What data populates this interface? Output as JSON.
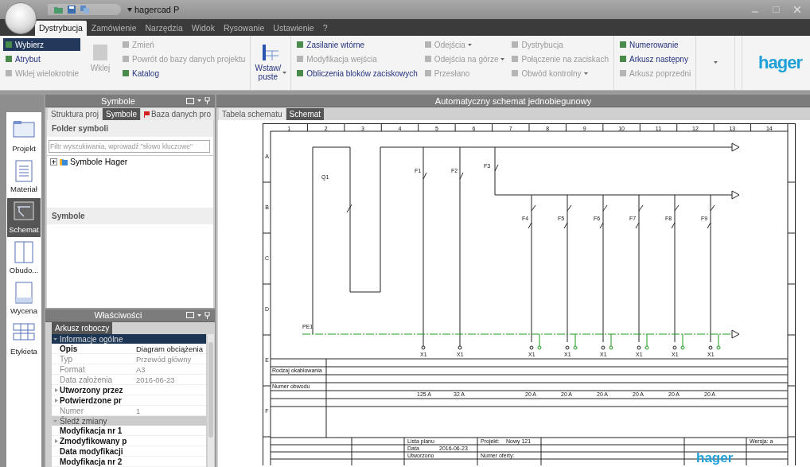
{
  "window": {
    "title": "hagercad P"
  },
  "menu_tabs": [
    {
      "label": "Dystrybucja",
      "selected": true
    },
    {
      "label": "Zamówienie",
      "selected": false
    },
    {
      "label": "Narzędzia",
      "selected": false
    },
    {
      "label": "Widok",
      "selected": false
    },
    {
      "label": "Rysowanie",
      "selected": false
    },
    {
      "label": "Ustawienie",
      "selected": false
    },
    {
      "label": "?",
      "selected": false
    }
  ],
  "ribbon": {
    "groups": [
      {
        "columns": [
          [
            {
              "kind": "small",
              "label": "Wybierz",
              "selected": true,
              "disabled": false
            },
            {
              "kind": "small",
              "label": "Atrybut",
              "selected": false,
              "disabled": false
            },
            {
              "kind": "small",
              "label": "Wklej wielokrotnie",
              "selected": false,
              "disabled": true
            }
          ],
          [
            {
              "kind": "large",
              "label": "Wklej",
              "disabled": true,
              "dropdown": false
            }
          ],
          [
            {
              "kind": "small",
              "label": "Zmień",
              "selected": false,
              "disabled": true
            },
            {
              "kind": "small",
              "label": "Powrót do bazy danych projektu",
              "selected": false,
              "disabled": true
            },
            {
              "kind": "small",
              "label": "Katalog",
              "selected": false,
              "disabled": false
            }
          ]
        ]
      },
      {
        "columns": [
          [
            {
              "kind": "large",
              "label": "Wstaw/ puste",
              "disabled": false,
              "dropdown": true
            }
          ]
        ]
      },
      {
        "columns": [
          [
            {
              "kind": "small",
              "label": "Zasilanie wtórne",
              "selected": false,
              "disabled": false
            },
            {
              "kind": "small",
              "label": "Modyfikacja wejścia",
              "selected": false,
              "disabled": true
            },
            {
              "kind": "small",
              "label": "Obliczenia bloków zaciskowych",
              "selected": false,
              "disabled": false
            }
          ],
          [
            {
              "kind": "small",
              "label": "Odejścia",
              "selected": false,
              "disabled": true,
              "dropdown": true
            },
            {
              "kind": "small",
              "label": "Odejścia na górze",
              "selected": false,
              "disabled": true,
              "dropdown": true
            },
            {
              "kind": "small",
              "label": "Przesłano",
              "selected": false,
              "disabled": true
            }
          ],
          [
            {
              "kind": "small",
              "label": "Dystrybucja",
              "selected": false,
              "disabled": true
            },
            {
              "kind": "small",
              "label": "Połączenie na zaciskach",
              "selected": false,
              "disabled": true
            },
            {
              "kind": "small",
              "label": "Obwód kontrolny",
              "selected": false,
              "disabled": true,
              "dropdown": true
            }
          ]
        ]
      },
      {
        "columns": [
          [
            {
              "kind": "small",
              "label": "Numerowanie",
              "selected": false,
              "disabled": false
            },
            {
              "kind": "small",
              "label": "Arkusz następny",
              "selected": false,
              "disabled": false
            },
            {
              "kind": "small",
              "label": "Arkusz poprzedni",
              "selected": false,
              "disabled": true
            }
          ]
        ]
      },
      {
        "columns": [
          [
            {
              "kind": "menu",
              "dropdown": true
            }
          ]
        ]
      }
    ],
    "logo": "hager"
  },
  "nav": [
    {
      "label": "Projekt",
      "selected": false
    },
    {
      "label": "Materiał",
      "selected": false
    },
    {
      "label": "Schemat",
      "selected": true
    },
    {
      "label": "Obudo...",
      "selected": false
    },
    {
      "label": "Wycena",
      "selected": false
    },
    {
      "label": "Etykieta",
      "selected": false
    }
  ],
  "symbols_panel": {
    "title": "Symbole",
    "tabs": [
      {
        "label": "Struktura proj",
        "selected": false
      },
      {
        "label": "Symbole",
        "selected": true
      },
      {
        "label": "Baza danych pro",
        "selected": false
      }
    ],
    "folder_heading": "Folder symboli",
    "search": {
      "placeholder": "Filtr wyszukiwania, wprowadź \"słowo kluczowe\""
    },
    "tree": [
      {
        "label": "Symbole Hager",
        "expanded": false
      }
    ],
    "symbols_heading": "Symbole"
  },
  "properties_panel": {
    "title": "Właściwości",
    "tabs": [
      {
        "label": "Arkusz roboczy",
        "selected": true
      }
    ],
    "groups": [
      {
        "label": "Informacje ogólne",
        "selected": true,
        "expanded": true,
        "rows": [
          {
            "name": "Opis",
            "value": "Diagram obciążenia",
            "readonly": false,
            "kind": "plain"
          },
          {
            "name": "Typ",
            "value": "Przewód główny",
            "readonly": true,
            "kind": "plain"
          },
          {
            "name": "Format",
            "value": "A3",
            "readonly": true,
            "kind": "plain"
          },
          {
            "name": "Data założenia",
            "value": "2016-06-23",
            "readonly": true,
            "kind": "plain"
          },
          {
            "name": "Utworzony przez",
            "readonly": false,
            "kind": "expandable"
          },
          {
            "name": "Potwierdzone pr",
            "readonly": false,
            "kind": "expandable"
          },
          {
            "name": "Numer",
            "value": "1",
            "readonly": true,
            "kind": "plain"
          }
        ]
      },
      {
        "label": "Śledź zmiany",
        "selected": false,
        "expanded": true,
        "rows": [
          {
            "name": "Modyfikacja nr 1",
            "readonly": false,
            "kind": "plain"
          },
          {
            "name": "Zmodyfikowany p",
            "readonly": false,
            "kind": "expandable"
          },
          {
            "name": "Data modyfikacji",
            "readonly": false,
            "kind": "plain"
          },
          {
            "name": "Modyfikacja nr 2",
            "readonly": false,
            "kind": "plain"
          }
        ]
      }
    ]
  },
  "main_panel": {
    "title": "Automatyczny schemat jednobiegunowy",
    "tabs": [
      {
        "label": "Tabela schematu",
        "selected": false
      },
      {
        "label": "Schemat",
        "selected": true
      }
    ],
    "sheet": {
      "columns": [
        "1",
        "2",
        "3",
        "4",
        "5",
        "6",
        "7",
        "8",
        "9",
        "10",
        "11",
        "12",
        "13",
        "14"
      ],
      "rows": [
        "A",
        "B",
        "C",
        "D",
        "E",
        "F"
      ],
      "main_device": "Q1",
      "pe_label": "PE1",
      "feeders": [
        {
          "device": "F1",
          "terminal": "X1",
          "current": "125 A"
        },
        {
          "device": "F2",
          "terminal": "X1",
          "current": "32 A"
        }
      ],
      "rcd": "F3",
      "outputs": [
        {
          "device": "F4",
          "terminal": "X1",
          "current": "20 A"
        },
        {
          "device": "F5",
          "terminal": "X1",
          "current": "20 A"
        },
        {
          "device": "F6",
          "terminal": "X1",
          "current": "20 A"
        },
        {
          "device": "F7",
          "terminal": "X1",
          "current": "20 A"
        },
        {
          "device": "F8",
          "terminal": "X1",
          "current": "20 A"
        },
        {
          "device": "F9",
          "terminal": "X1",
          "current": "20 A"
        }
      ],
      "table_labels": [
        "Rodzaj okablowania",
        "Numer obwodu"
      ],
      "title_block": [
        {
          "label": "Lista planu"
        },
        {
          "label": "Data",
          "value": "2016-06-23"
        },
        {
          "label": "Utworzono"
        }
      ],
      "project_label": "Projekt:",
      "project_name": "Nowy 121",
      "offer_label": "Numer oferty:",
      "version": "Wersja: a",
      "logo": "hager"
    }
  }
}
